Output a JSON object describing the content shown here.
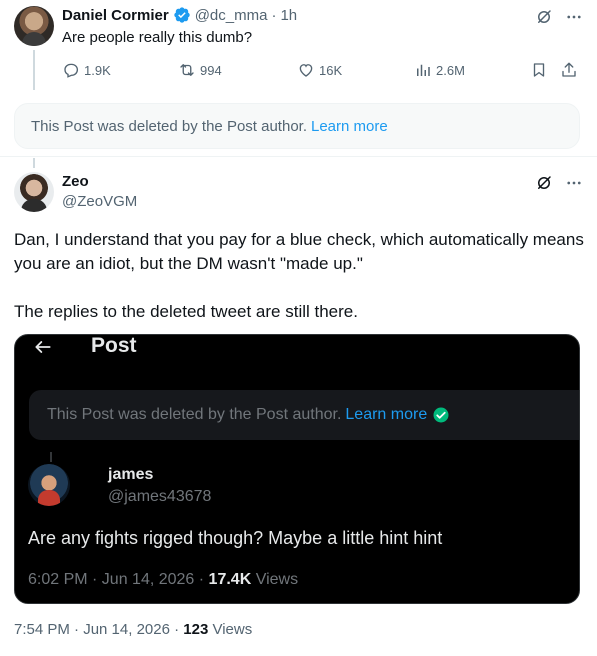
{
  "parent": {
    "name": "Daniel Cormier",
    "handle": "@dc_mma",
    "sep": "·",
    "time": "1h",
    "text": "Are people really this dumb?",
    "replies": "1.9K",
    "reposts": "994",
    "likes": "16K",
    "views": "2.6M"
  },
  "deleted_notice": {
    "text": "This Post was deleted by the Post author.",
    "link": "Learn more"
  },
  "reply": {
    "name": "Zeo",
    "handle": "@ZeoVGM",
    "paragraph1": "Dan, I understand that you pay for a blue check, which automatically means you are an idiot, but the DM wasn't \"made up.\"",
    "paragraph2": "The replies to the deleted tweet are still there.",
    "meta_time": "7:54 PM · Jun 14, 2026 · ",
    "meta_views_count": "123",
    "meta_views_label": " Views"
  },
  "embed": {
    "title": "Post",
    "deleted_text": "This Post was deleted by the Post author.",
    "deleted_link": "Learn more",
    "name": "james",
    "handle": "@james43678",
    "text": "Are any fights rigged though? Maybe a little hint hint",
    "meta_time": "6:02 PM · Jun 14, 2026 · ",
    "meta_views_count": "17.4K",
    "meta_views_label": " Views"
  },
  "colors": {
    "accent": "#1d9bf0",
    "muted_text": "#536471",
    "dark_bg": "#000000"
  },
  "icons": {
    "verified": "verified-badge-icon",
    "grok": "grok-icon",
    "more": "more-icon",
    "reply": "reply-icon",
    "repost": "repost-icon",
    "like": "like-icon",
    "views": "views-icon",
    "bookmark": "bookmark-icon",
    "share": "share-icon",
    "back": "back-arrow-icon"
  }
}
